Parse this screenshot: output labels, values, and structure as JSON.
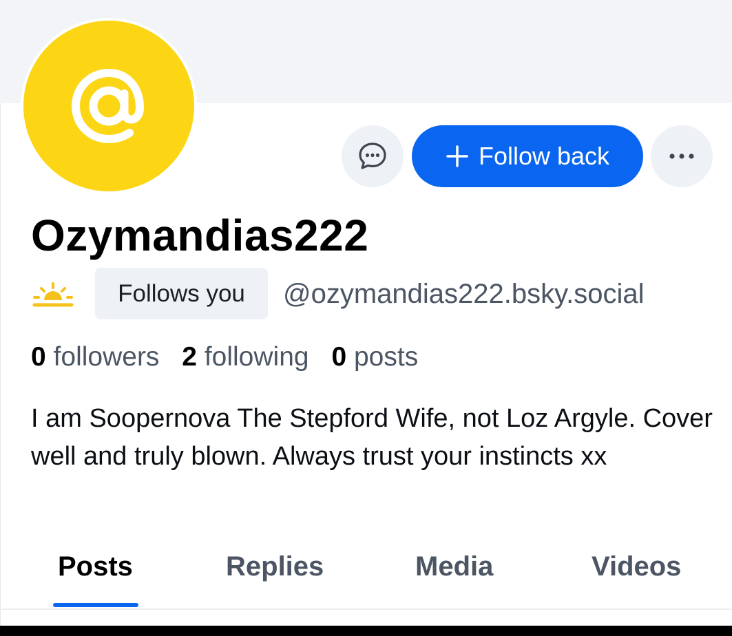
{
  "profile": {
    "display_name": "Ozymandias222",
    "handle": "@ozymandias222.bsky.social",
    "follows_you_label": "Follows you",
    "bio": "I am Soopernova The Stepford Wife, not Loz Argyle. Cover well and truly blown. Always trust your instincts xx",
    "avatar_icon": "at-sign-icon",
    "avatar_color": "#fcd514"
  },
  "actions": {
    "follow_back_label": "Follow back",
    "follow_back_color": "#0a66f0",
    "message_icon": "chat-bubble-icon",
    "more_icon": "ellipsis-icon",
    "follow_icon": "plus-icon"
  },
  "stats": {
    "followers_count": "0",
    "followers_label": "followers",
    "following_count": "2",
    "following_label": "following",
    "posts_count": "0",
    "posts_label": "posts"
  },
  "tabs": [
    {
      "label": "Posts",
      "active": true
    },
    {
      "label": "Replies",
      "active": false
    },
    {
      "label": "Media",
      "active": false
    },
    {
      "label": "Videos",
      "active": false
    }
  ]
}
